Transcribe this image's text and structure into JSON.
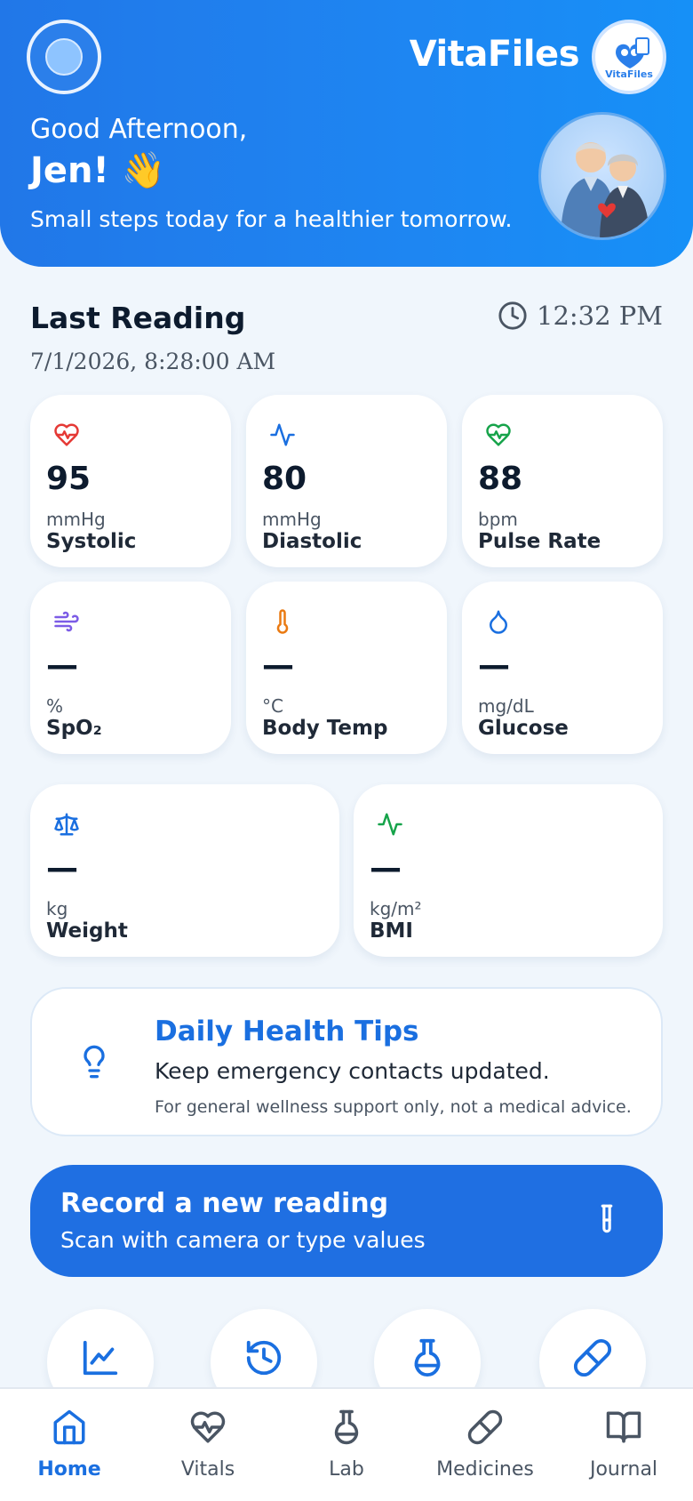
{
  "header": {
    "brand": "VitaFiles",
    "logo_text": "VitaFiles",
    "greeting": "Good Afternoon,",
    "name": "Jen! 👋",
    "tagline": "Small steps today for a healthier tomorrow."
  },
  "last_reading": {
    "title": "Last Reading",
    "date": "7/1/2026, 8:28:00 AM",
    "time": "12:32 PM"
  },
  "vitals": [
    {
      "label": "Systolic",
      "value": "95",
      "unit": "mmHg",
      "icon": "heart-pulse-icon",
      "color": "#e53935"
    },
    {
      "label": "Diastolic",
      "value": "80",
      "unit": "mmHg",
      "icon": "activity-icon",
      "color": "#1a6fe0"
    },
    {
      "label": "Pulse Rate",
      "value": "88",
      "unit": "bpm",
      "icon": "heart-pulse-icon",
      "color": "#16a34a"
    },
    {
      "label": "SpO₂",
      "value": "—",
      "unit": "%",
      "icon": "wind-icon",
      "color": "#7c5ce6"
    },
    {
      "label": "Body Temp",
      "value": "—",
      "unit": "°C",
      "icon": "thermometer-icon",
      "color": "#ea7a12"
    },
    {
      "label": "Glucose",
      "value": "—",
      "unit": "mg/dL",
      "icon": "droplet-icon",
      "color": "#1a6fe0"
    },
    {
      "label": "Weight",
      "value": "—",
      "unit": "kg",
      "icon": "scale-icon",
      "color": "#1a6fe0"
    },
    {
      "label": "BMI",
      "value": "—",
      "unit": "kg/m²",
      "icon": "activity-icon",
      "color": "#16a34a"
    }
  ],
  "tips": {
    "title": "Daily Health Tips",
    "tip": "Keep emergency contacts updated.",
    "disclaimer": "For general wellness support only, not a medical advice."
  },
  "record": {
    "title": "Record a new reading",
    "subtitle": "Scan with camera or type values"
  },
  "quick_actions": [
    "chart-icon",
    "history-icon",
    "flask-icon",
    "pill-icon"
  ],
  "nav": [
    {
      "label": "Home",
      "icon": "home-icon",
      "active": true
    },
    {
      "label": "Vitals",
      "icon": "heart-pulse-icon",
      "active": false
    },
    {
      "label": "Lab",
      "icon": "flask-icon",
      "active": false
    },
    {
      "label": "Medicines",
      "icon": "pill-icon",
      "active": false
    },
    {
      "label": "Journal",
      "icon": "book-icon",
      "active": false
    }
  ],
  "colors": {
    "primary": "#1f6fe2",
    "header_gradient_end": "#1690f7",
    "background": "#f0f6fc"
  }
}
